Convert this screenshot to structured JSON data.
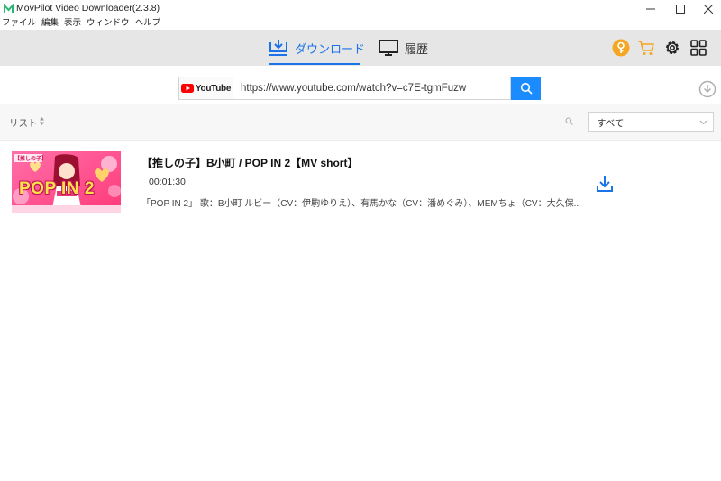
{
  "window": {
    "title": "MovPilot Video Downloader(2.3.8)"
  },
  "menu": [
    "ファイル",
    "編集",
    "表示",
    "ウィンドウ",
    "ヘルプ"
  ],
  "tabs": {
    "download": "ダウンロード",
    "history": "履歴"
  },
  "toolbar_icons": [
    "key-icon",
    "cart-icon",
    "gear-icon",
    "grid-icon"
  ],
  "url_bar": {
    "brand": "YouTube",
    "value": "https://www.youtube.com/watch?v=c7E-tgmFuzw"
  },
  "list": {
    "label": "リスト",
    "filter_value": "すべて"
  },
  "video": {
    "title": "【推しの子】B小町 / POP IN 2【MV short】",
    "duration": "00:01:30",
    "description": "「POP IN 2」 歌：B小町 ルビー（CV：伊駒ゆりえ）、有馬かな（CV：潘めぐみ）、MEMちょ（CV：大久保...",
    "thumbnail_caption": "POP IN 2",
    "thumbnail_tag": "【推しの子】"
  },
  "colors": {
    "accent": "#1a73e8",
    "search_button": "#1a8cff",
    "toolbar_bg": "#e6e6e6",
    "key_icon": "#f5a623",
    "cart_icon": "#f5a623"
  }
}
